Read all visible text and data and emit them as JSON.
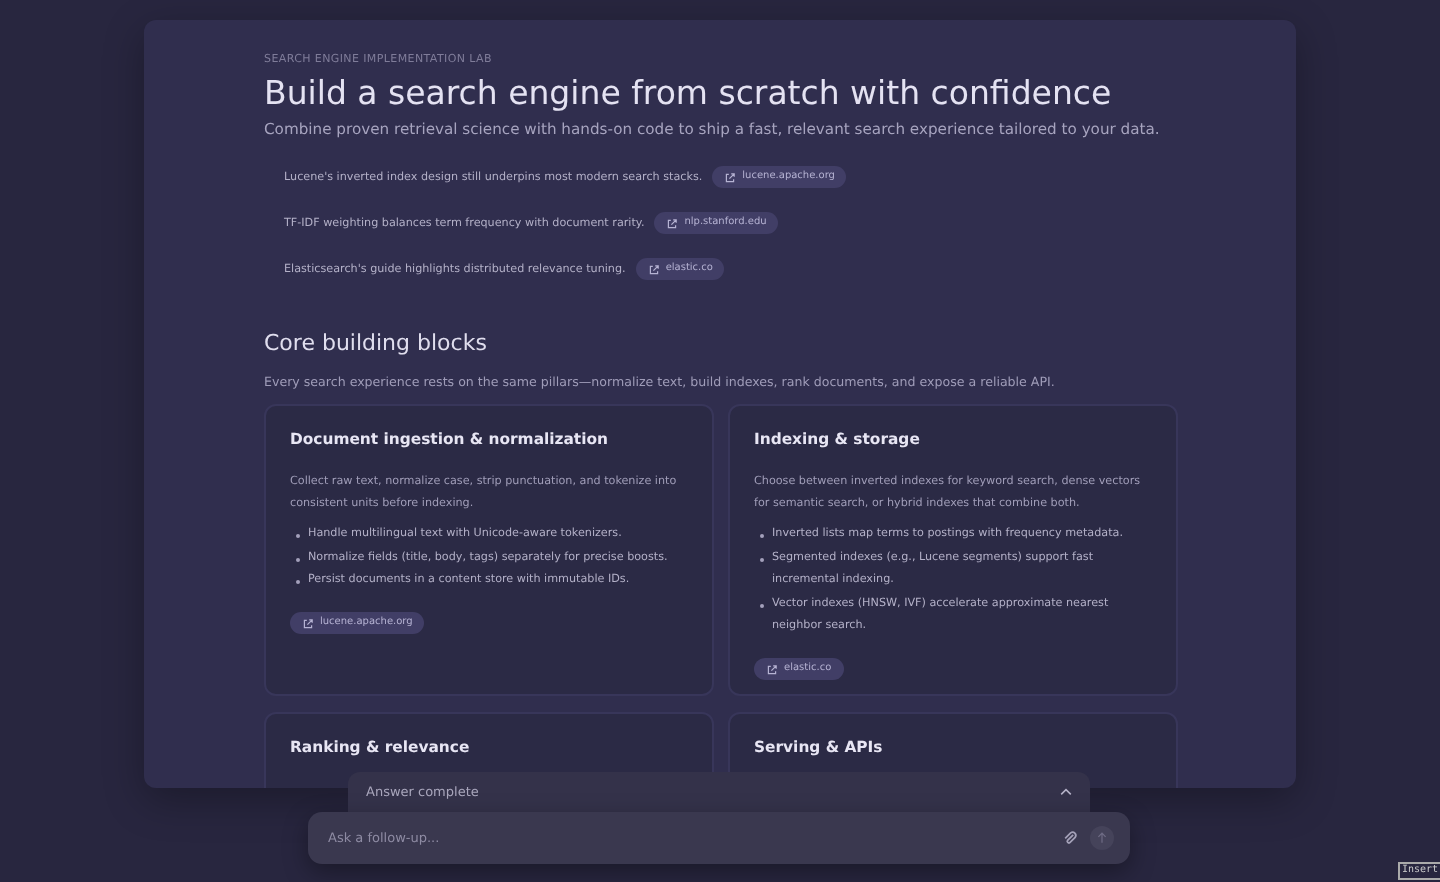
{
  "eyebrow": "SEARCH ENGINE IMPLEMENTATION LAB",
  "title": "Build a search engine from scratch with confidence",
  "subtitle": "Combine proven retrieval science with hands-on code to ship a fast, relevant search experience tailored to your data.",
  "facts": [
    {
      "text": "Lucene's inverted index design still underpins most modern search stacks.",
      "source": "lucene.apache.org"
    },
    {
      "text": "TF-IDF weighting balances term frequency with document rarity.",
      "source": "nlp.stanford.edu"
    },
    {
      "text": "Elasticsearch's guide highlights distributed relevance tuning.",
      "source": "elastic.co"
    }
  ],
  "section": {
    "heading": "Core building blocks",
    "description": "Every search experience rests on the same pillars—normalize text, build indexes, rank documents, and expose a reliable API."
  },
  "cards": [
    {
      "title": "Document ingestion & normalization",
      "text": "Collect raw text, normalize case, strip punctuation, and tokenize into consistent units before indexing.",
      "bullets": [
        "Handle multilingual text with Unicode-aware tokenizers.",
        "Normalize fields (title, body, tags) separately for precise boosts.",
        "Persist documents in a content store with immutable IDs."
      ],
      "source": "lucene.apache.org"
    },
    {
      "title": "Indexing & storage",
      "text": "Choose between inverted indexes for keyword search, dense vectors for semantic search, or hybrid indexes that combine both.",
      "bullets": [
        "Inverted lists map terms to postings with frequency metadata.",
        "Segmented indexes (e.g., Lucene segments) support fast incremental indexing.",
        "Vector indexes (HNSW, IVF) accelerate approximate nearest neighbor search."
      ],
      "source": "elastic.co"
    },
    {
      "title": "Ranking & relevance"
    },
    {
      "title": "Serving & APIs"
    }
  ],
  "status": {
    "label": "Answer complete",
    "expanded": false
  },
  "composer": {
    "placeholder": "Ask a follow-up..."
  },
  "key_badge": "Insert"
}
